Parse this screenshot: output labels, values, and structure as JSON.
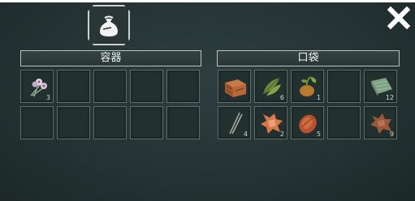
{
  "container": {
    "title": "容器",
    "slots": [
      {
        "item": "flower-bundle-icon",
        "count": "3"
      },
      {
        "item": null,
        "count": ""
      },
      {
        "item": null,
        "count": ""
      },
      {
        "item": null,
        "count": ""
      },
      {
        "item": null,
        "count": ""
      },
      {
        "item": null,
        "count": ""
      },
      {
        "item": null,
        "count": ""
      },
      {
        "item": null,
        "count": ""
      },
      {
        "item": null,
        "count": ""
      },
      {
        "item": null,
        "count": ""
      }
    ]
  },
  "pocket": {
    "title": "口袋",
    "slots": [
      {
        "item": "wooden-crate-icon",
        "count": ""
      },
      {
        "item": "green-leaves-icon",
        "count": "6"
      },
      {
        "item": "sprouting-seed-icon",
        "count": "1"
      },
      {
        "item": null,
        "count": ""
      },
      {
        "item": "cloth-bundle-icon",
        "count": "12"
      },
      {
        "item": "sticks-icon",
        "count": "4"
      },
      {
        "item": "orange-hide-icon",
        "count": "2"
      },
      {
        "item": "raw-meat-icon",
        "count": "5"
      },
      {
        "item": null,
        "count": ""
      },
      {
        "item": "brown-hide-icon",
        "count": "9"
      }
    ]
  }
}
